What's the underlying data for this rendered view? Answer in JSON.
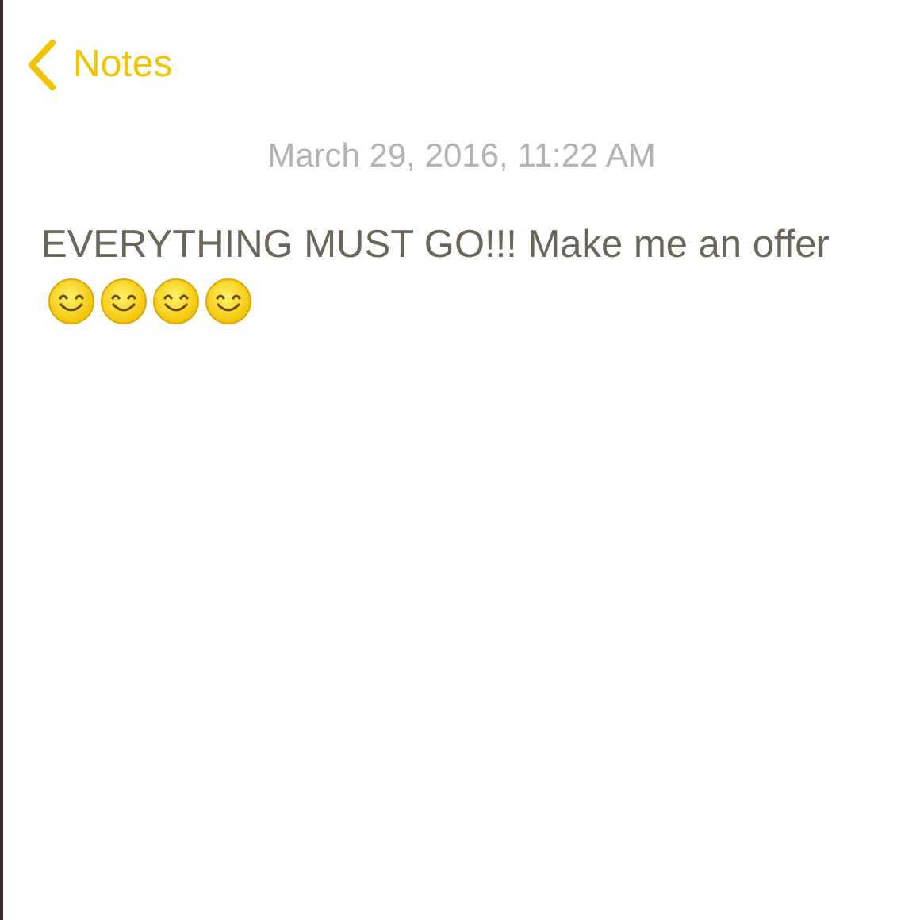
{
  "nav": {
    "back_label": "Notes"
  },
  "note": {
    "date": "March 29, 2016, 11:22 AM",
    "text": "EVERYTHING MUST GO!!! Make me an offer",
    "emoji": [
      {
        "kind": "smiling"
      },
      {
        "kind": "smiling"
      },
      {
        "kind": "smiling"
      },
      {
        "kind": "smiling"
      }
    ]
  }
}
